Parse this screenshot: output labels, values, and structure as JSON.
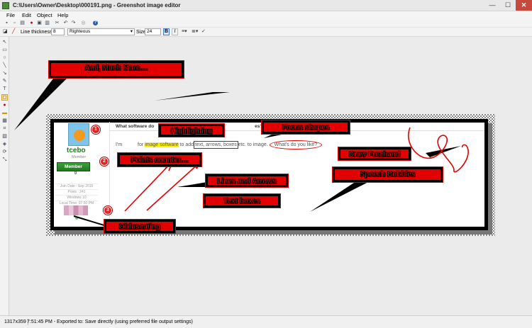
{
  "window": {
    "title": "C:\\Users\\Owner\\Desktop\\000191.png - Greenshot image editor",
    "minimize": "—",
    "maximize": "☐",
    "close": "✕"
  },
  "menu": {
    "items": [
      "File",
      "Edit",
      "Object",
      "Help"
    ]
  },
  "props": {
    "line_thickness_label": "Line thickness",
    "line_thickness_value": "8",
    "font_value": "Righteous",
    "size_label": "Size",
    "size_value": "24",
    "bold": "B",
    "italic": "I"
  },
  "post": {
    "thread_title_a": "What software do",
    "thread_title_b": "es?",
    "text_pre": "I'm ",
    "text_mid1": " for ",
    "highlight": "image software",
    "text_mid2": " to add ",
    "focus_text": "text, arrows, boxes",
    "text_mid3": " etc. to image. ",
    "ellipse_text": "What's do you like?",
    "username": "tcebo",
    "user_title": "Member",
    "badge": "Member",
    "rep": "0",
    "stats": [
      "Join Date : Sep 2015",
      "Posts : 241",
      "Windows 10",
      "Local Time: 07:50 PM"
    ]
  },
  "callouts": {
    "more": "And, Much More....",
    "highlighting": "Highlighting",
    "focus": "Focus shapes",
    "freehand": "Draw Freehand",
    "points": "Points counter....",
    "speech": "Speech Bubbles",
    "lines": "Lines and Arrows",
    "textboxes": "Text boxes",
    "obfuscating": "Obfuscating"
  },
  "counters": [
    "1",
    "2",
    "3"
  ],
  "status": {
    "dimensions": "1317x359",
    "message": "7:51:45 PM - Exported to: Save directly (using preferred file output settings)"
  },
  "colors": {
    "callout_fill": "#e30000",
    "callout_border": "#000000",
    "highlight": "#fff200",
    "close_button": "#c7493d"
  },
  "icons": [
    "save-icon",
    "copy-icon",
    "print-icon",
    "undo-icon",
    "redo-icon",
    "help-icon",
    "pen-icon",
    "rectangle-icon",
    "ellipse-icon",
    "line-icon",
    "arrow-icon",
    "text-icon",
    "highlight-icon",
    "obfuscate-icon",
    "crop-icon"
  ]
}
